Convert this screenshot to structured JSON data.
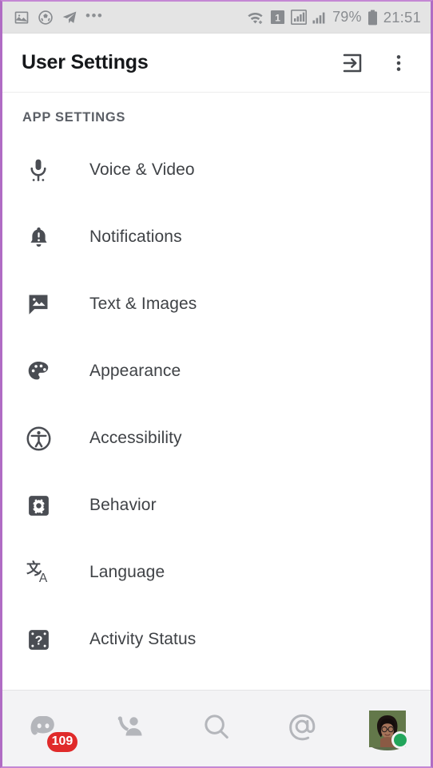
{
  "statusbar": {
    "left_icons": [
      {
        "name": "photo-icon",
        "glyph": "photo"
      },
      {
        "name": "soccer-ball-icon",
        "glyph": "soccer"
      },
      {
        "name": "telegram-icon",
        "glyph": "plane"
      },
      {
        "name": "more-notifications-icon",
        "glyph": "..."
      }
    ],
    "ellipsis": "•••",
    "wifi_icon": "wifi-plus-icon",
    "sim_label": "1",
    "signal_icon_1": "signal-bars-icon",
    "signal_icon_2": "signal-bars-small-icon",
    "battery_percent": "79%",
    "battery_icon": "battery-icon",
    "clock": "21:51"
  },
  "header": {
    "title": "User Settings",
    "logout_icon": "logout-icon",
    "overflow_icon": "overflow-menu-icon"
  },
  "main": {
    "section_title": "APP SETTINGS",
    "items": [
      {
        "label": "Voice & Video",
        "icon": "microphone-icon"
      },
      {
        "label": "Notifications",
        "icon": "bell-alert-icon"
      },
      {
        "label": "Text & Images",
        "icon": "chat-image-icon"
      },
      {
        "label": "Appearance",
        "icon": "palette-icon"
      },
      {
        "label": "Accessibility",
        "icon": "accessibility-icon"
      },
      {
        "label": "Behavior",
        "icon": "gear-square-icon"
      },
      {
        "label": "Language",
        "icon": "translate-icon"
      },
      {
        "label": "Activity Status",
        "icon": "activity-status-icon"
      }
    ]
  },
  "bottomnav": {
    "items": [
      {
        "name": "servers",
        "icon": "discord-servers-icon",
        "badge": "109"
      },
      {
        "name": "friends",
        "icon": "friends-icon",
        "badge": ""
      },
      {
        "name": "search",
        "icon": "search-icon",
        "badge": ""
      },
      {
        "name": "mentions",
        "icon": "mentions-at-icon",
        "badge": ""
      },
      {
        "name": "profile",
        "icon": "avatar",
        "badge": ""
      }
    ],
    "presence": "online"
  },
  "colors": {
    "badge_red": "#e02a2a",
    "online_green": "#22a55b",
    "frame_purple": "#b06cc4",
    "text_primary": "#3f4246",
    "statusbar_bg": "#e4e4e4"
  }
}
